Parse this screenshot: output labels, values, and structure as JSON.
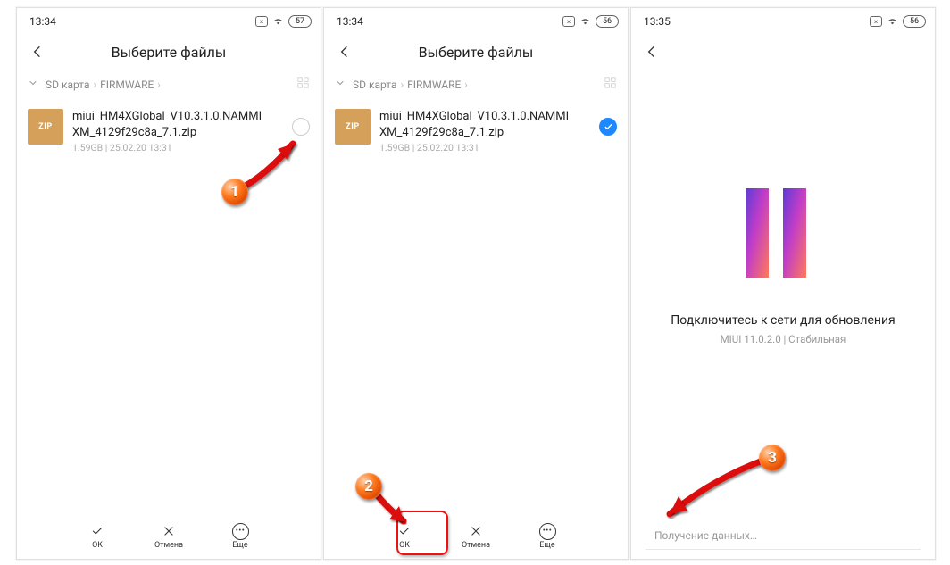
{
  "screens": [
    {
      "status_time": "13:34",
      "battery": "57",
      "header_title": "Выберите файлы",
      "breadcrumb": [
        "SD карта",
        "FIRMWARE"
      ],
      "file": {
        "name_line1": "miui_HM4XGlobal_V10.3.1.0.NAMMI",
        "name_line2": "XM_4129f29c8a_7.1.zip",
        "size": "1.59GB",
        "date": "25.02.20 13:31",
        "zip_label": "ZIP",
        "selected": false
      },
      "actions": {
        "ok": "OK",
        "cancel": "Отмена",
        "more": "Еще"
      }
    },
    {
      "status_time": "13:34",
      "battery": "56",
      "header_title": "Выберите файлы",
      "breadcrumb": [
        "SD карта",
        "FIRMWARE"
      ],
      "file": {
        "name_line1": "miui_HM4XGlobal_V10.3.1.0.NAMMI",
        "name_line2": "XM_4129f29c8a_7.1.zip",
        "size": "1.59GB",
        "date": "25.02.20 13:31",
        "zip_label": "ZIP",
        "selected": true
      },
      "actions": {
        "ok": "OK",
        "cancel": "Отмена",
        "more": "Еще"
      }
    },
    {
      "status_time": "13:35",
      "battery": "56",
      "update_message": "Подключитесь к сети для обновления",
      "update_version": "MIUI 11.0.2.0 | Стабильная",
      "receiving": "Получение данных…"
    }
  ],
  "annotations": {
    "step1": "1",
    "step2": "2",
    "step3": "3"
  },
  "icons": {
    "back": "‹",
    "chevron": "⌄",
    "crumb_sep": "›",
    "check": "✓",
    "close": "✕",
    "more": "•••",
    "wifi": "wifi"
  }
}
